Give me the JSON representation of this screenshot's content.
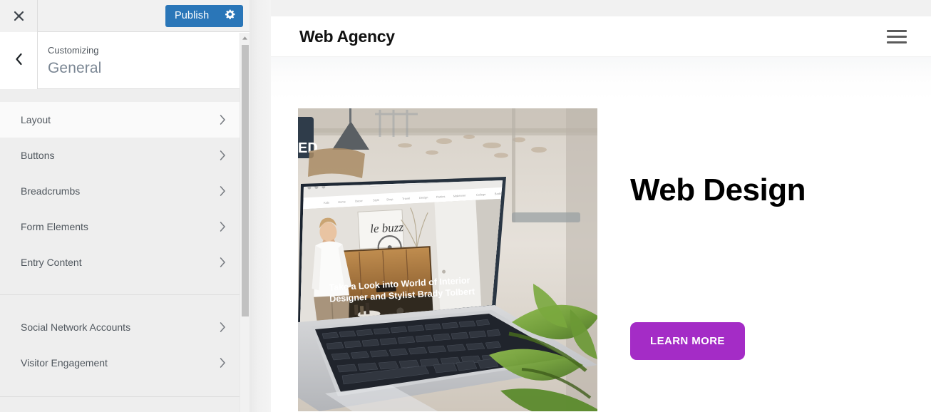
{
  "customizer": {
    "close_label": "Close",
    "close_icon": "close-icon",
    "publish_label": "Publish",
    "gear_icon": "gear-icon",
    "back_icon": "chevron-left-icon",
    "eyebrow": "Customizing",
    "title": "General",
    "accent_blue": "#2a76b8",
    "panel_bg": "#eeeeee",
    "groups": [
      {
        "items": [
          {
            "label": "Layout",
            "icon": "chevron-right-icon",
            "hover": true
          },
          {
            "label": "Buttons",
            "icon": "chevron-right-icon",
            "hover": false
          },
          {
            "label": "Breadcrumbs",
            "icon": "chevron-right-icon",
            "hover": false
          },
          {
            "label": "Form Elements",
            "icon": "chevron-right-icon",
            "hover": false
          },
          {
            "label": "Entry Content",
            "icon": "chevron-right-icon",
            "hover": false
          }
        ]
      },
      {
        "items": [
          {
            "label": "Social Network Accounts",
            "icon": "chevron-right-icon",
            "hover": false
          },
          {
            "label": "Visitor Engagement",
            "icon": "chevron-right-icon",
            "hover": false
          }
        ]
      }
    ],
    "scrollbar": {
      "up_arrow_icon": "scroll-up-arrow-icon"
    }
  },
  "preview": {
    "site_title": "Web Agency",
    "menu_icon": "hamburger-menu-icon",
    "hero": {
      "heading": "Web Design",
      "cta_label": "LEARN MORE",
      "cta_color": "#a42cc6",
      "image_alt": "Laptop on a desk displaying an interior design website, green plant in foreground",
      "image_screen_text": {
        "brand": "le buzz",
        "caption_line1": "Take a Look into World of Interior",
        "caption_line2": "Designer and Stylist Brady Tolbert"
      }
    }
  }
}
